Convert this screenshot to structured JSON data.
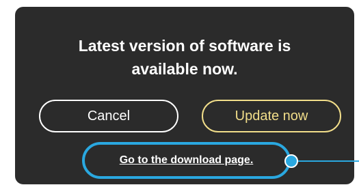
{
  "dialog": {
    "title": "Latest  version of software is\navailable now.",
    "cancel_label": "Cancel",
    "update_label": "Update now",
    "download_link_label": "Go to the download page."
  },
  "colors": {
    "dialog_background": "#2b2b2b",
    "update_accent": "#f2de8a",
    "highlight": "#2aa8e0"
  }
}
